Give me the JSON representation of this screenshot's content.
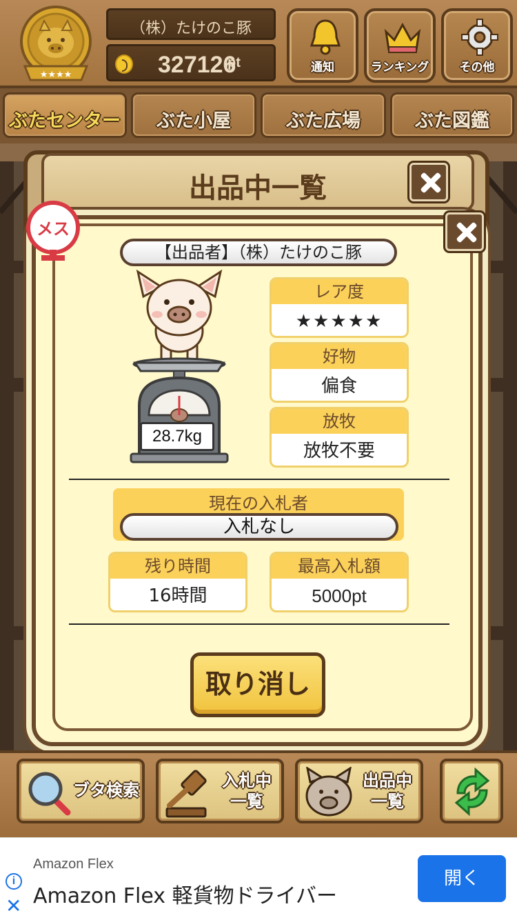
{
  "header": {
    "company_name": "（株）たけのこ豚",
    "points_value": "327126",
    "points_unit": "pt",
    "buttons": [
      {
        "label": "通知",
        "icon": "bell-icon"
      },
      {
        "label": "ランキング",
        "icon": "crown-icon"
      },
      {
        "label": "その他",
        "icon": "gear-icon"
      }
    ]
  },
  "nav": {
    "tabs": [
      {
        "label": "ぶたセンター",
        "active": true
      },
      {
        "label": "ぶた小屋",
        "active": false
      },
      {
        "label": "ぶた広場",
        "active": false
      },
      {
        "label": "ぶた図鑑",
        "active": false
      }
    ]
  },
  "list_panel": {
    "title": "出品中一覧"
  },
  "detail": {
    "gender_label": "メス",
    "seller": "【出品者】（株）たけのこ豚",
    "weight": "28.7kg",
    "rarity": {
      "header": "レア度",
      "stars": "★★★★★",
      "count": 5
    },
    "favorite": {
      "header": "好物",
      "value": "偏食"
    },
    "grazing": {
      "header": "放牧",
      "value": "放牧不要"
    },
    "current_bidder": {
      "header": "現在の入札者",
      "value": "入札なし"
    },
    "remaining_time": {
      "header": "残り時間",
      "value": "16時間"
    },
    "highest_bid": {
      "header": "最高入札額",
      "value": "5000pt"
    },
    "cancel_label": "取り消し"
  },
  "bottom_bar": {
    "search": "ブタ検索",
    "bidding_line1": "入札中",
    "bidding_line2": "一覧",
    "listing_line1": "出品中",
    "listing_line2": "一覧"
  },
  "ad": {
    "sponsor": "Amazon Flex",
    "title": "Amazon Flex 軽貨物ドライバー",
    "cta": "開く"
  },
  "colors": {
    "wood": "#a3743f",
    "dark_wood": "#5a3b1c",
    "cream": "#fff9cc",
    "yellow_header": "#fbd15a",
    "star_red": "#e0656c",
    "ad_blue": "#1a73e8"
  }
}
